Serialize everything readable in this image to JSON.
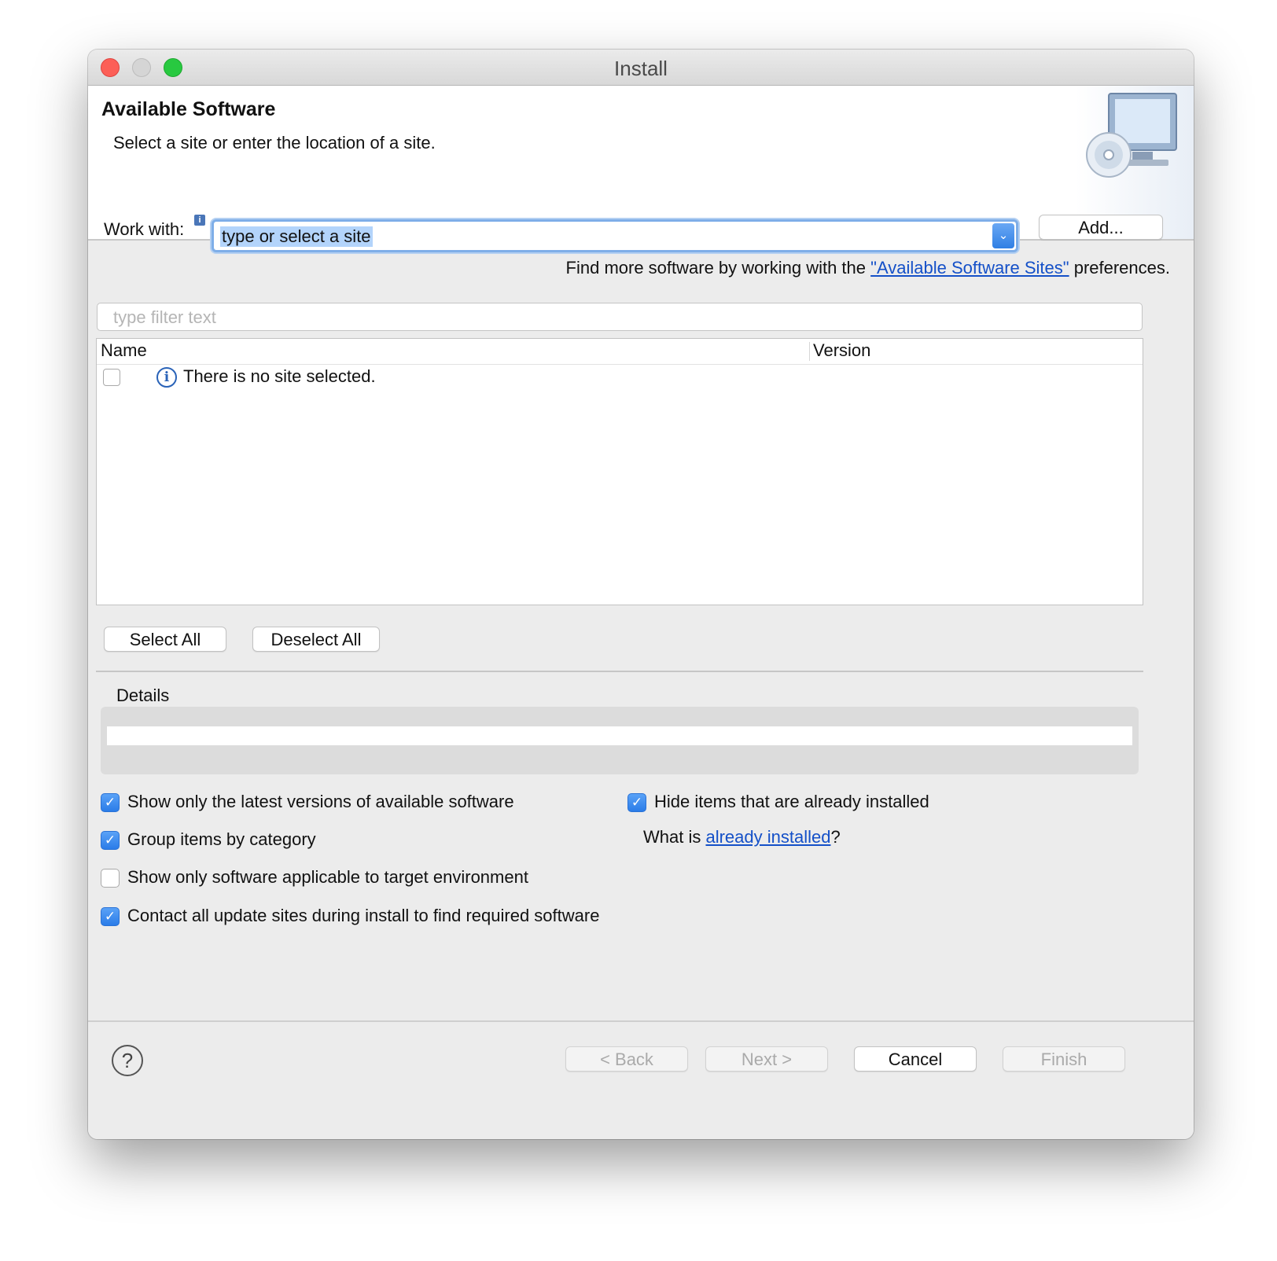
{
  "window": {
    "title": "Install"
  },
  "header": {
    "title": "Available Software",
    "description": "Select a site or enter the location of a site."
  },
  "work_with": {
    "label": "Work with:",
    "value": "type or select a site",
    "add_button": "Add..."
  },
  "find_more": {
    "prefix": "Find more software by working with the ",
    "link": "\"Available Software Sites\"",
    "suffix": " preferences."
  },
  "filter": {
    "placeholder": "type filter text"
  },
  "table": {
    "columns": [
      "Name",
      "Version"
    ],
    "empty_message": "There is no site selected."
  },
  "selection_buttons": {
    "select_all": "Select All",
    "deselect_all": "Deselect All"
  },
  "details": {
    "label": "Details"
  },
  "options": [
    {
      "label": "Show only the latest versions of available software",
      "checked": true
    },
    {
      "label": "Group items by category",
      "checked": true
    },
    {
      "label": "Show only software applicable to target environment",
      "checked": false
    },
    {
      "label": "Contact all update sites during install to find required software",
      "checked": true
    },
    {
      "label": "Hide items that are already installed",
      "checked": true
    }
  ],
  "installed_query": {
    "prefix": "What is ",
    "link": "already installed",
    "suffix": "?"
  },
  "footer": {
    "back": "< Back",
    "next": "Next >",
    "cancel": "Cancel",
    "finish": "Finish"
  },
  "colors": {
    "accent": "#2a7ce8",
    "link": "#1450c8",
    "selection": "#b3d4fb"
  }
}
